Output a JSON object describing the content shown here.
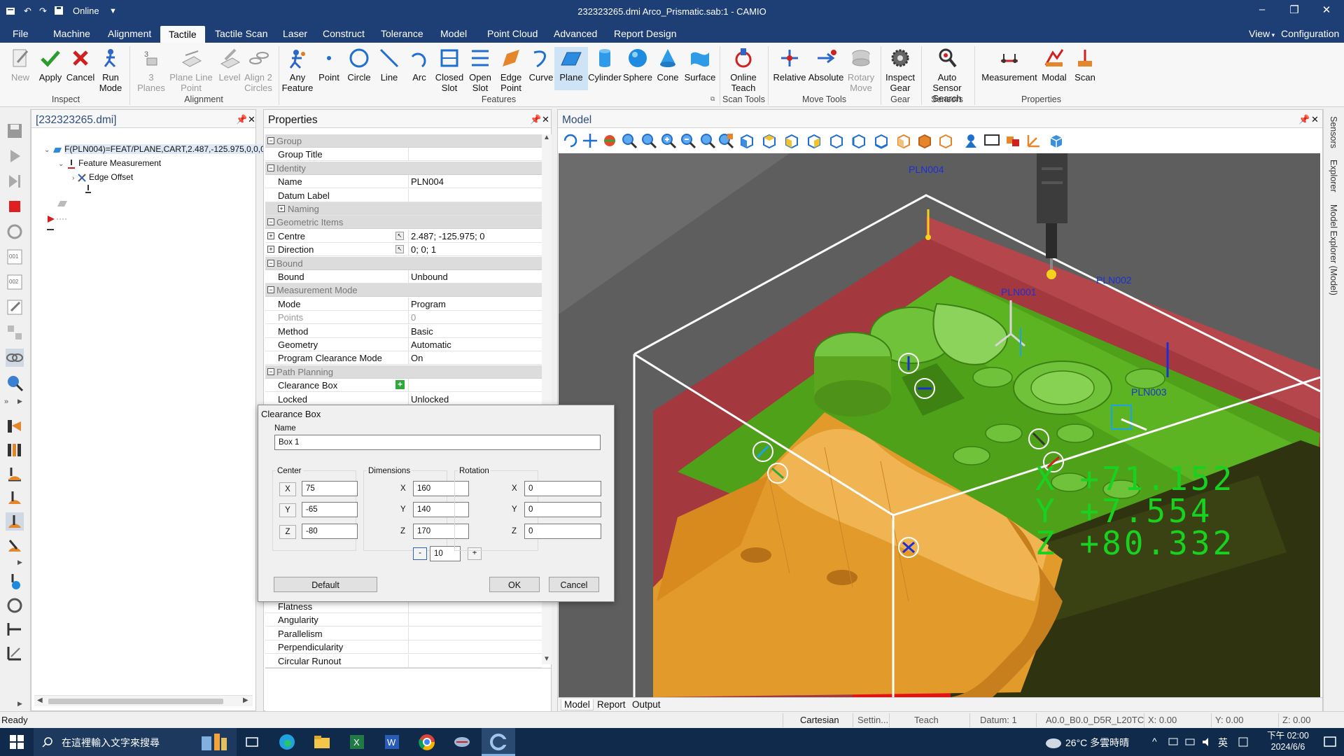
{
  "window": {
    "quick_access": [
      "Online"
    ],
    "title": "232323265.dmi  Arco_Prismatic.sab:1 - CAMIO",
    "minimize": "–",
    "restore": "❐",
    "close": "✕"
  },
  "menu": {
    "file": "File",
    "tabs": [
      "Machine",
      "Alignment",
      "Tactile",
      "Tactile Scan",
      "Laser",
      "Construct",
      "Tolerance",
      "Model",
      "Point Cloud",
      "Advanced",
      "Report Design"
    ],
    "active_tab": "Tactile",
    "right": [
      "View",
      "Configuration"
    ]
  },
  "ribbon": {
    "inspect": {
      "label": "Inspect",
      "buttons": [
        "New",
        "Apply",
        "Cancel",
        "Run Mode"
      ]
    },
    "alignment": {
      "label": "Alignment",
      "buttons": [
        "3 Planes",
        "Plane Line Point",
        "Level",
        "Align 2 Circles"
      ]
    },
    "features": {
      "label": "Features",
      "buttons": [
        "Any Feature",
        "Point",
        "Circle",
        "Line",
        "Arc",
        "Closed Slot",
        "Open Slot",
        "Edge Point",
        "Curve",
        "Plane",
        "Cylinder",
        "Sphere",
        "Cone",
        "Surface"
      ]
    },
    "scan_tools": {
      "label": "Scan Tools",
      "buttons": [
        "Online Teach"
      ]
    },
    "move_tools": {
      "label": "Move Tools",
      "buttons": [
        "Relative",
        "Absolute",
        "Rotary Move"
      ]
    },
    "gear": {
      "label": "Gear",
      "buttons": [
        "Inspect Gear"
      ]
    },
    "sensors": {
      "label": "Sensors",
      "buttons": [
        "Auto Sensor Search"
      ]
    },
    "properties": {
      "label": "Properties",
      "buttons": [
        "Measurement",
        "Modal",
        "Scan"
      ]
    }
  },
  "tree": {
    "title": "[232323265.dmi]",
    "items": [
      "F(PLN004)=FEAT/PLANE,CART,2.487,-125.975,0,0,0",
      "Feature Measurement",
      "Edge Offset"
    ]
  },
  "properties": {
    "title": "Properties",
    "rows": [
      {
        "type": "cat",
        "key": "Group"
      },
      {
        "type": "row",
        "key": "Group Title",
        "value": ""
      },
      {
        "type": "cat",
        "key": "Identity"
      },
      {
        "type": "row",
        "key": "Name",
        "value": "PLN004"
      },
      {
        "type": "row",
        "key": "Datum Label",
        "value": ""
      },
      {
        "type": "sub",
        "key": "Naming"
      },
      {
        "type": "cat",
        "key": "Geometric Items"
      },
      {
        "type": "row",
        "key": "Centre",
        "value": "2.487; -125.975; 0"
      },
      {
        "type": "row",
        "key": "Direction",
        "value": "0; 0; 1"
      },
      {
        "type": "cat",
        "key": "Bound"
      },
      {
        "type": "row",
        "key": "Bound",
        "value": "Unbound"
      },
      {
        "type": "cat",
        "key": "Measurement Mode"
      },
      {
        "type": "row",
        "key": "Mode",
        "value": "Program"
      },
      {
        "type": "row",
        "key": "Points",
        "value": "0"
      },
      {
        "type": "row",
        "key": "Method",
        "value": "Basic"
      },
      {
        "type": "row",
        "key": "Geometry",
        "value": "Automatic"
      },
      {
        "type": "row",
        "key": "Program Clearance Mode",
        "value": "On"
      },
      {
        "type": "cat",
        "key": "Path Planning"
      },
      {
        "type": "row",
        "key": "Clearance Box",
        "value": ""
      },
      {
        "type": "row",
        "key": "Locked",
        "value": "Unlocked"
      }
    ],
    "lower_rows": [
      "Flatness",
      "Angularity",
      "Parallelism",
      "Perpendicularity",
      "Circular Runout"
    ]
  },
  "dialog": {
    "title": "Clearance Box",
    "name_label": "Name",
    "name_value": "Box 1",
    "center": {
      "label": "Center",
      "x": "75",
      "y": "-65",
      "z": "-80"
    },
    "dimensions": {
      "label": "Dimensions",
      "x": "160",
      "y": "140",
      "z": "170",
      "step": "10"
    },
    "rotation": {
      "label": "Rotation",
      "x": "0",
      "y": "0",
      "z": "0"
    },
    "axes": [
      "X",
      "Y",
      "Z"
    ],
    "minus": "-",
    "plus": "+",
    "default_btn": "Default",
    "ok_btn": "OK",
    "cancel_btn": "Cancel"
  },
  "model": {
    "title": "Model",
    "labels": [
      "PLN004",
      "PLN001",
      "PLN002",
      "PLN003"
    ],
    "dro": {
      "x": "X  +71.152",
      "y": "Y  +7.554",
      "z": "Z  +80.332"
    },
    "tabs": [
      "Model",
      "Report",
      "Output"
    ]
  },
  "side_tabs": [
    "Sensors",
    "Explorer",
    "Model Explorer (Model)"
  ],
  "status": {
    "ready": "Ready",
    "cartesian": "Cartesian",
    "settings": "Settin...",
    "teach": "Teach",
    "datum": "Datum: 1",
    "probe": "A0.0_B0.0_D5R_L20TC",
    "x": "X: 0.00",
    "y": "Y: 0.00",
    "z": "Z: 0.00"
  },
  "taskbar": {
    "search": "在這裡輸入文字來搜尋",
    "weather": "26°C  多雲時晴",
    "ime": "英",
    "time": "下午 02:00",
    "date": "2024/6/6"
  },
  "colors": {
    "title_bar": "#1e3f75",
    "part_green": "#4fa11a",
    "part_orange": "#e29a2b",
    "clearance_red": "#a3393f",
    "dro_green": "#19d11f",
    "label_blue": "#1c2fd6"
  }
}
